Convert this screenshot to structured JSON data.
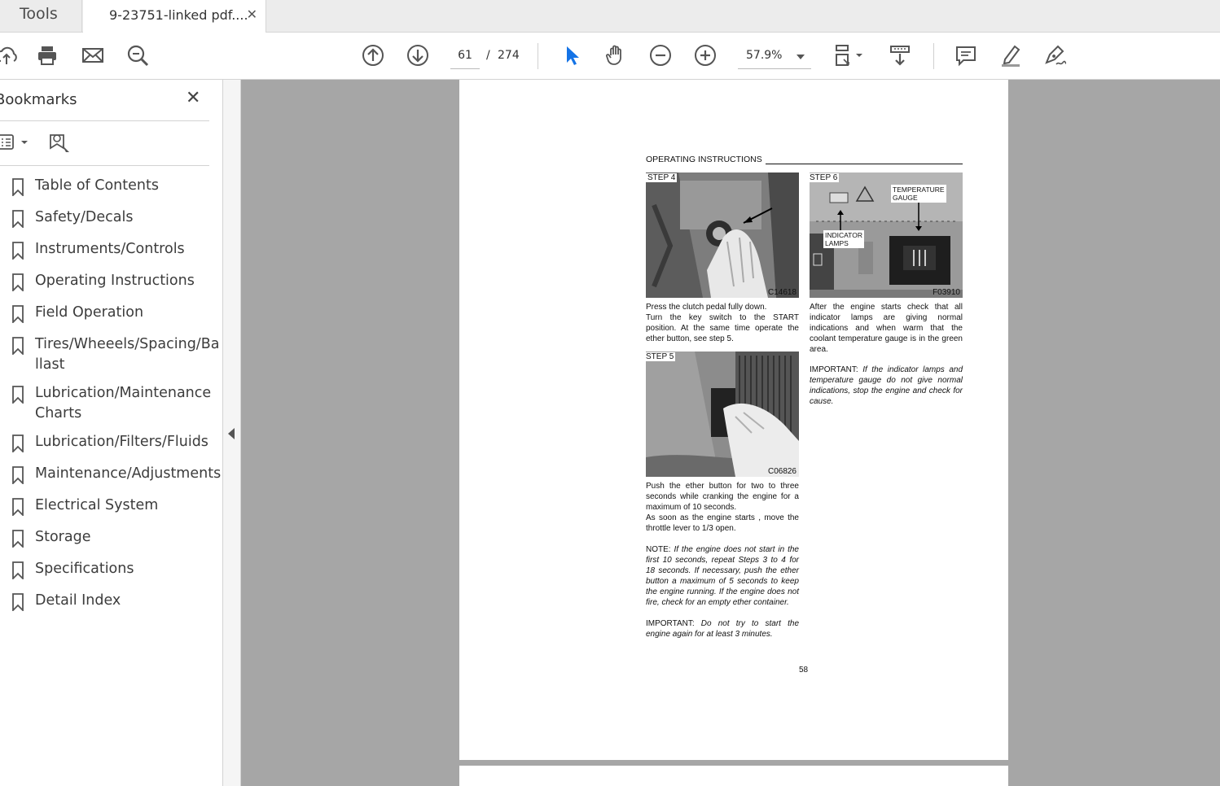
{
  "tabs": {
    "tools_label": "Tools",
    "document_label": "9-23751-linked pdf....",
    "close_glyph": "✕"
  },
  "toolbar": {
    "current_page": "61",
    "separator": "/",
    "total_pages": "274",
    "zoom": "57.9%",
    "icons": [
      "upload-icon",
      "print-icon",
      "mail-icon",
      "zoom-search-icon",
      "page-up-icon",
      "page-down-icon",
      "select-cursor-icon",
      "hand-icon",
      "zoom-out-icon",
      "zoom-in-icon",
      "page-layout-icon",
      "scroll-mode-icon",
      "comment-icon",
      "highlight-pen-icon",
      "sign-icon"
    ],
    "accent_color": "#1473e6"
  },
  "sidebar": {
    "title": "Bookmarks",
    "close_glyph": "✕",
    "items": [
      {
        "label": "Table of Contents"
      },
      {
        "label": "Safety/Decals"
      },
      {
        "label": "Instruments/Controls"
      },
      {
        "label": "Operating Instructions"
      },
      {
        "label": "Field Operation"
      },
      {
        "label": "Tires/Wheeels/Spacing/Ballast"
      },
      {
        "label": "Lubrication/Maintenance Charts"
      },
      {
        "label": "Lubrication/Filters/Fluids"
      },
      {
        "label": "Maintenance/Adjustments"
      },
      {
        "label": "Electrical System"
      },
      {
        "label": "Storage"
      },
      {
        "label": "Specifications"
      },
      {
        "label": "Detail Index"
      }
    ]
  },
  "page": {
    "section_title": "OPERATING INSTRUCTIONS",
    "step4": {
      "label": "STEP 4",
      "photo_code": "C14618",
      "text1": "Press the clutch pedal fully down.",
      "text2": "Turn the key switch to the START position. At the same time operate the ether button, see step 5."
    },
    "step5": {
      "label": "STEP 5",
      "photo_code": "C06826",
      "text1": "Push the ether button for two to three seconds while cranking the engine for a maximum of 10 seconds.",
      "text2": "As soon as the engine starts , move the throttle lever to 1/3 open.",
      "note_label": "NOTE:",
      "note_text": "If the engine does not start in the first 10 seconds, repeat Steps 3 to 4 for 18 seconds. If necessary, push the ether button a maximum of 5 seconds to keep the engine running. If the engine does not fire, check for an empty ether container.",
      "important_label": "IMPORTANT:",
      "important_text": "Do not try to start the engine again for at least 3 minutes."
    },
    "step6": {
      "label": "STEP 6",
      "photo_code": "F03910",
      "callout_temp_line1": "TEMPERATURE",
      "callout_temp_line2": "GAUGE",
      "callout_lamps_line1": "INDICATOR",
      "callout_lamps_line2": "LAMPS",
      "text1": "After the engine starts check that all indicator lamps are giving normal indications and when warm that the coolant temperature gauge is in the green area.",
      "important_label": "IMPORTANT:",
      "important_text": "If the indicator lamps and temperature gauge do not give normal indications, stop the engine and check for cause."
    },
    "page_number": "58"
  }
}
